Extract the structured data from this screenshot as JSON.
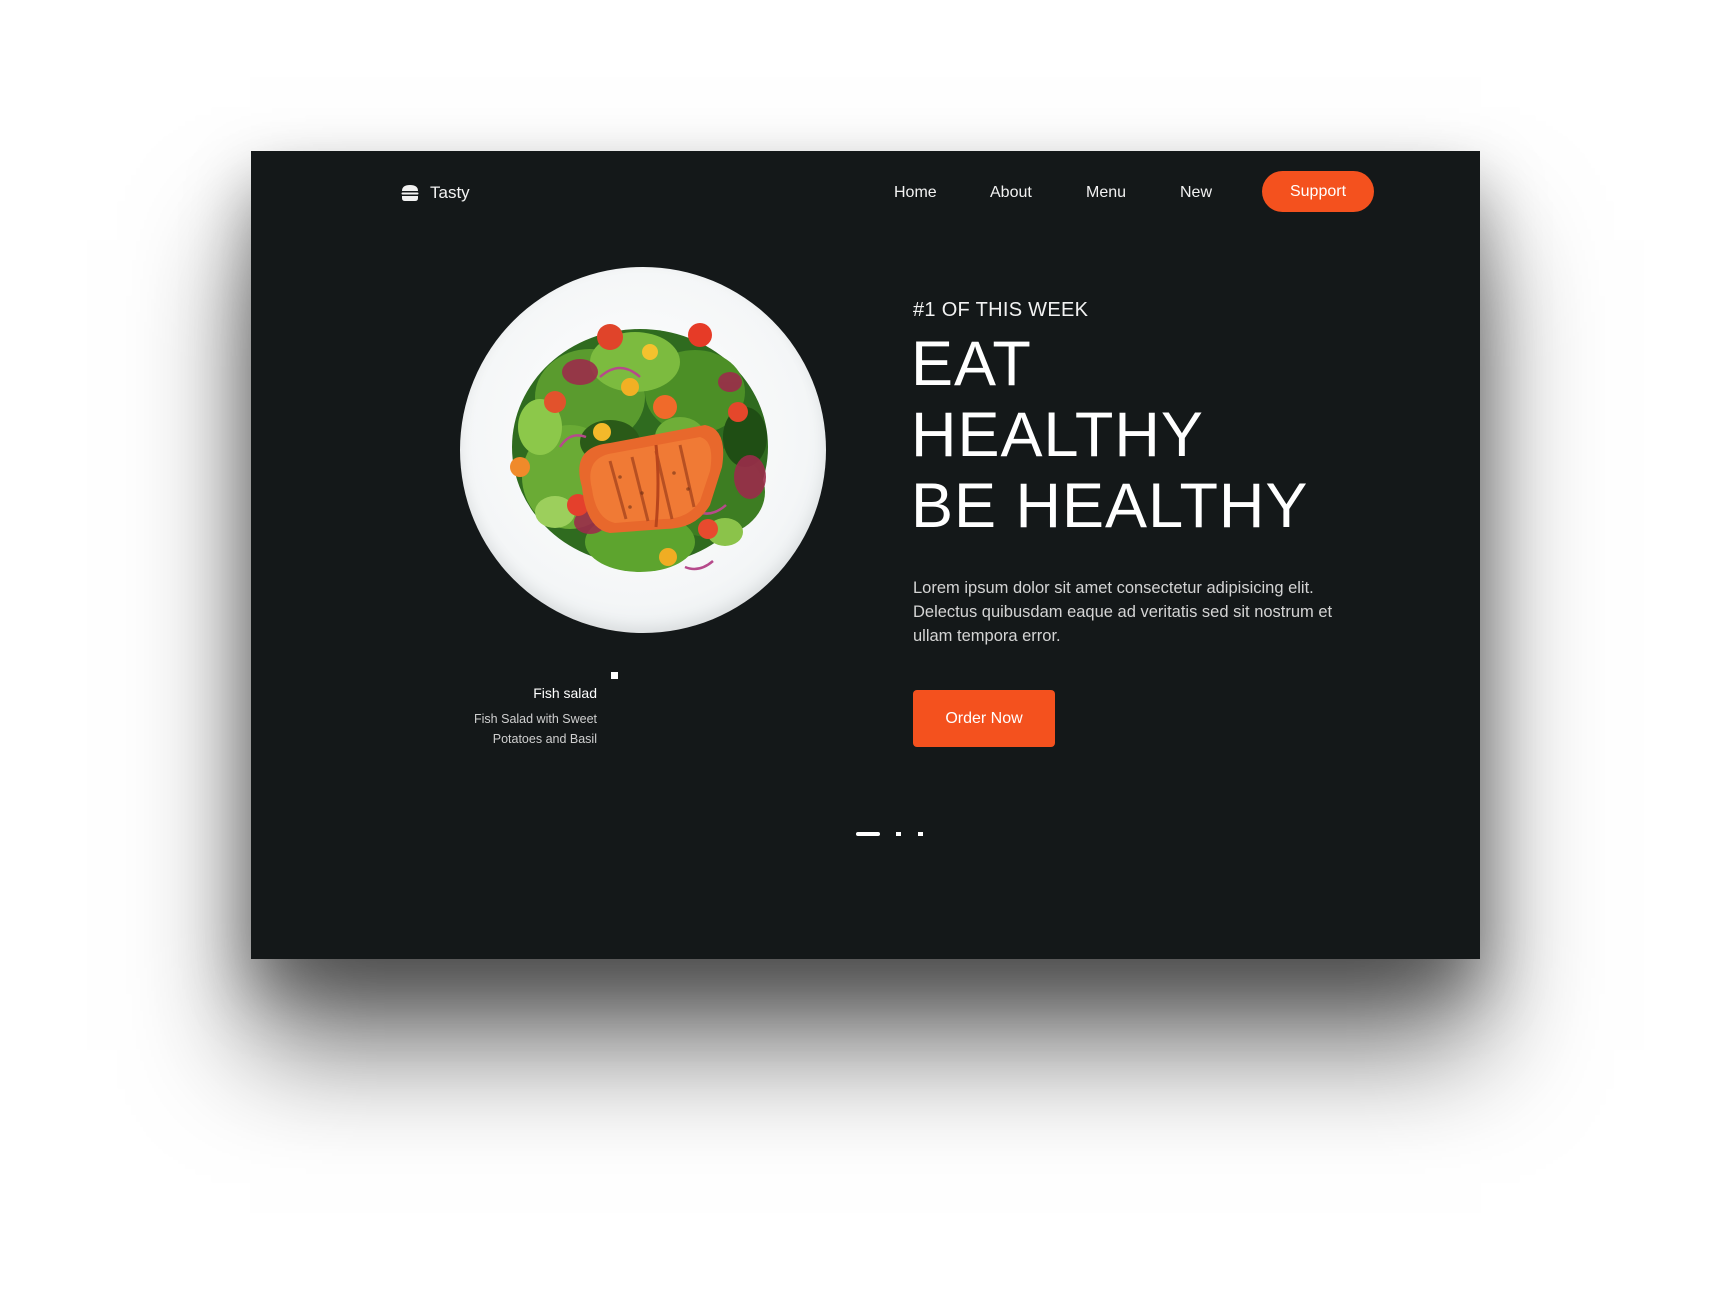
{
  "brand": {
    "name": "Tasty",
    "icon": "burger-icon"
  },
  "nav": {
    "items": [
      {
        "label": "Home"
      },
      {
        "label": "About"
      },
      {
        "label": "Menu"
      },
      {
        "label": "New"
      }
    ],
    "support_label": "Support"
  },
  "hero": {
    "kicker": "#1 OF THIS WEEK",
    "headline": [
      "EAT",
      "HEALTHY",
      "BE HEALTHY"
    ],
    "body": "Lorem ipsum dolor sit amet consectetur adipisicing elit. Delectus quibusdam eaque ad veritatis sed sit nostrum et ullam tempora error.",
    "cta_label": "Order Now"
  },
  "dish": {
    "title": "Fish salad",
    "description_lines": [
      "Fish Salad with Sweet",
      "Potatoes and Basil"
    ]
  },
  "pagination": {
    "count": 3,
    "active": 1
  },
  "colors": {
    "background": "#141819",
    "accent": "#f4511e",
    "text": "#ffffff"
  }
}
